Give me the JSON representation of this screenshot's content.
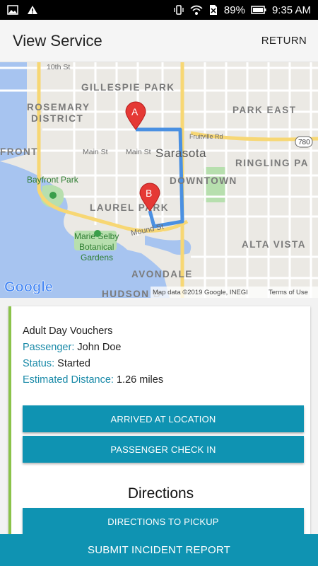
{
  "status_bar": {
    "battery": "89%",
    "time": "9:35 AM"
  },
  "header": {
    "title": "View Service",
    "return_label": "RETURN"
  },
  "map": {
    "labels": {
      "st10": "10th St",
      "gillespie": "GILLESPIE PARK",
      "rosemary1": "ROSEMARY",
      "rosemary2": "DISTRICT",
      "parkeast": "PARK EAST",
      "fruitville": "Fruitville Rd",
      "front": "FRONT",
      "main1": "Main St",
      "main2": "Main St",
      "sarasota": "Sarasota",
      "ringling": "RINGLING PA",
      "downtown": "DOWNTOWN",
      "bayfront": "Bayfront Park",
      "laurel": "LAUREL PARK",
      "mound": "Mound St",
      "selby1": "Marie Selby",
      "selby2": "Botanical",
      "selby3": "Gardens",
      "alta": "ALTA VISTA",
      "avondale": "AVONDALE",
      "hudson": "HUDSON B",
      "route780": "780",
      "pin_a": "A",
      "pin_b": "B"
    },
    "logo": "Google",
    "attribution": "Map data ©2019 Google, INEGI",
    "terms": "Terms of Use"
  },
  "service": {
    "name": "Adult Day Vouchers",
    "passenger_label": "Passenger:",
    "passenger": "John Doe",
    "status_label": "Status:",
    "status": "Started",
    "distance_label": "Estimated Distance:",
    "distance": "1.26 miles"
  },
  "buttons": {
    "arrived": "ARRIVED AT LOCATION",
    "checkin": "PASSENGER CHECK IN",
    "directions_heading": "Directions",
    "directions_pickup": "DIRECTIONS TO PICKUP",
    "submit": "SUBMIT INCIDENT REPORT"
  },
  "colors": {
    "accent": "#0f93b2",
    "label": "#1a8aa8",
    "card_border": "#8bc34a",
    "route": "#4a90e2",
    "pin": "#e53935"
  }
}
